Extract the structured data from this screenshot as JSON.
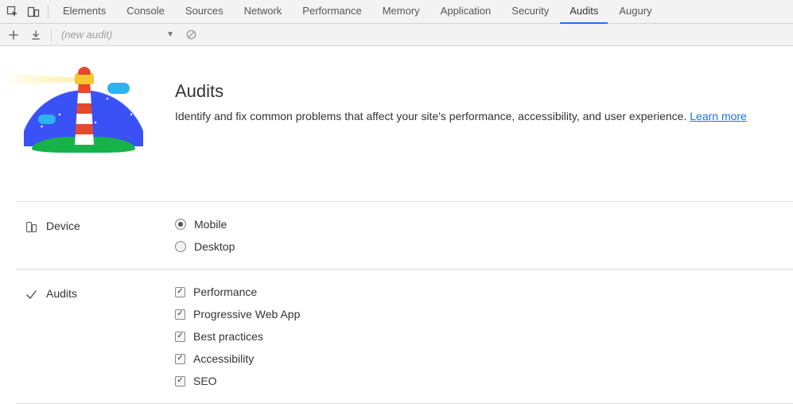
{
  "tabs": {
    "items": [
      {
        "label": "Elements"
      },
      {
        "label": "Console"
      },
      {
        "label": "Sources"
      },
      {
        "label": "Network"
      },
      {
        "label": "Performance"
      },
      {
        "label": "Memory"
      },
      {
        "label": "Application"
      },
      {
        "label": "Security"
      },
      {
        "label": "Audits"
      },
      {
        "label": "Augury"
      }
    ],
    "active_index": 8
  },
  "toolbar": {
    "audit_dropdown_placeholder": "(new audit)"
  },
  "header": {
    "title": "Audits",
    "description_prefix": "Identify and fix common problems that affect your site's performance, accessibility, and user experience. ",
    "learn_more_label": "Learn more"
  },
  "device_section": {
    "label": "Device",
    "options": [
      {
        "label": "Mobile",
        "checked": true
      },
      {
        "label": "Desktop",
        "checked": false
      }
    ]
  },
  "audits_section": {
    "label": "Audits",
    "options": [
      {
        "label": "Performance",
        "checked": true
      },
      {
        "label": "Progressive Web App",
        "checked": true
      },
      {
        "label": "Best practices",
        "checked": true
      },
      {
        "label": "Accessibility",
        "checked": true
      },
      {
        "label": "SEO",
        "checked": true
      }
    ]
  }
}
